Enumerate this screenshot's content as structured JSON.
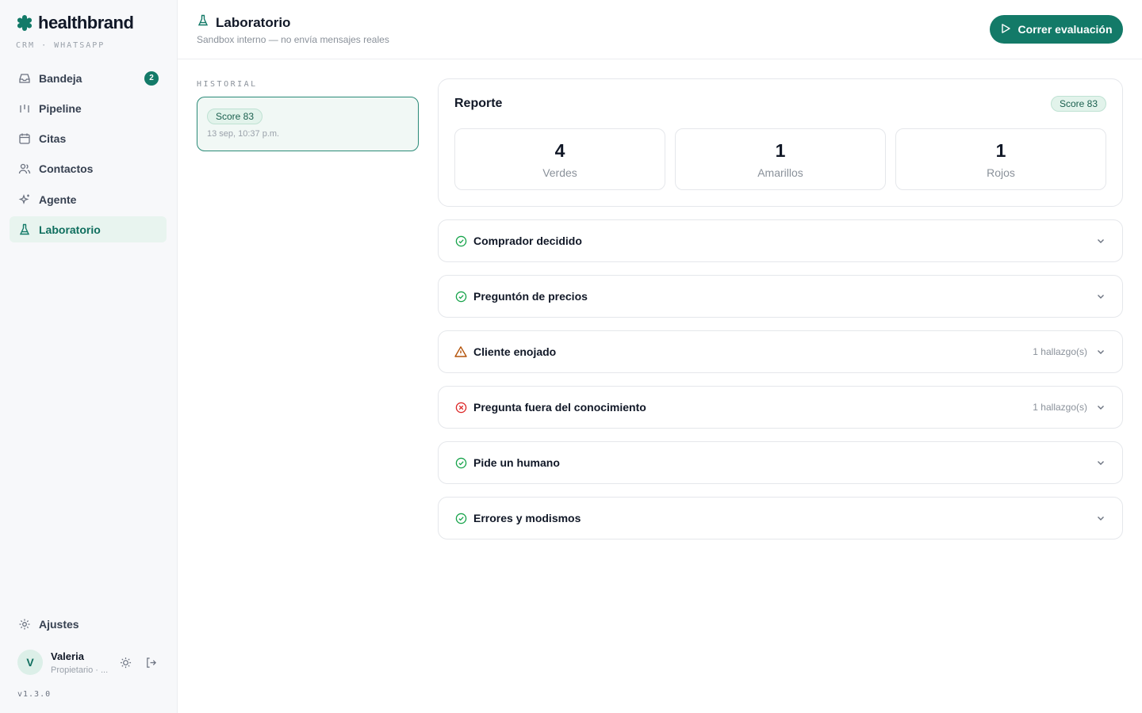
{
  "brand": {
    "name": "healthbrand",
    "subtitle": "CRM · WHATSAPP"
  },
  "sidebar": {
    "items": [
      {
        "label": "Bandeja",
        "icon": "inbox-icon",
        "badge": "2"
      },
      {
        "label": "Pipeline",
        "icon": "pipeline-icon"
      },
      {
        "label": "Citas",
        "icon": "calendar-icon"
      },
      {
        "label": "Contactos",
        "icon": "users-icon"
      },
      {
        "label": "Agente",
        "icon": "sparkles-icon"
      },
      {
        "label": "Laboratorio",
        "icon": "flask-icon",
        "active": true
      }
    ],
    "settings_label": "Ajustes",
    "user": {
      "initial": "V",
      "name": "Valeria",
      "role": "Propietario · ..."
    },
    "version": "v1.3.0"
  },
  "header": {
    "title": "Laboratorio",
    "subtitle": "Sandbox interno — no envía mensajes reales",
    "run_button": "Correr evaluación"
  },
  "history": {
    "label": "HISTORIAL",
    "items": [
      {
        "score": "Score 83",
        "date": "13 sep, 10:37 p.m."
      }
    ]
  },
  "report": {
    "title": "Reporte",
    "score": "Score 83",
    "stats": [
      {
        "value": "4",
        "label": "Verdes"
      },
      {
        "value": "1",
        "label": "Amarillos"
      },
      {
        "value": "1",
        "label": "Rojos"
      }
    ]
  },
  "scenarios": [
    {
      "title": "Comprador decidido",
      "status": "pass",
      "findings": ""
    },
    {
      "title": "Preguntón de precios",
      "status": "pass",
      "findings": ""
    },
    {
      "title": "Cliente enojado",
      "status": "warn",
      "findings": "1 hallazgo(s)"
    },
    {
      "title": "Pregunta fuera del conocimiento",
      "status": "fail",
      "findings": "1 hallazgo(s)"
    },
    {
      "title": "Pide un humano",
      "status": "pass",
      "findings": ""
    },
    {
      "title": "Errores y modismos",
      "status": "pass",
      "findings": ""
    }
  ],
  "colors": {
    "accent": "#137a68",
    "pass": "#16a34a",
    "warn": "#b45309",
    "fail": "#dc2626"
  }
}
